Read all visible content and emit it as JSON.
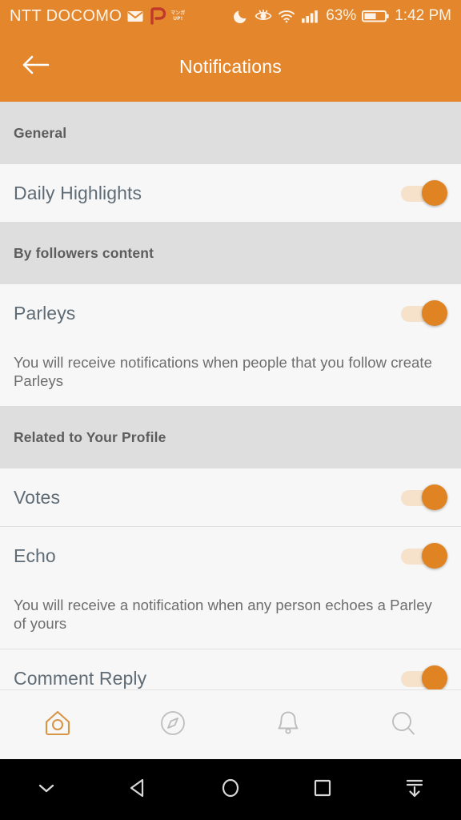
{
  "status_bar": {
    "carrier": "NTT DOCOMO",
    "battery_percent": "63%",
    "clock": "1:42 PM",
    "manga_badge_line1": "マンガ",
    "manga_badge_line2": "UP!",
    "icons": [
      "mail-icon",
      "parley-p-icon",
      "manga-up-badge-icon",
      "do-not-disturb-moon-icon",
      "eye-comfort-icon",
      "wifi-icon",
      "cellular-signal-icon",
      "battery-icon"
    ]
  },
  "app_bar": {
    "title": "Notifications",
    "back_label": "Back"
  },
  "colors": {
    "accent": "#e3862c",
    "toggle_on_thumb": "#e08323",
    "toggle_on_track": "#f6e2cb",
    "section_header_bg": "#dedede",
    "row_bg": "#f7f7f7",
    "row_title": "#5f6c76",
    "description_text": "#6d6d6d",
    "navbar_bg": "#000000"
  },
  "sections": [
    {
      "header": "General",
      "rows": [
        {
          "label": "Daily Highlights",
          "toggle": "on",
          "description": null
        }
      ]
    },
    {
      "header": "By followers content",
      "rows": [
        {
          "label": "Parleys",
          "toggle": "on",
          "description": "You will receive notifications when people that you follow create Parleys"
        }
      ]
    },
    {
      "header": "Related to Your Profile",
      "rows": [
        {
          "label": "Votes",
          "toggle": "on",
          "description": null
        },
        {
          "label": "Echo",
          "toggle": "on",
          "description": "You will receive a notification when any person echoes a Parley of yours"
        },
        {
          "label": "Comment Reply",
          "toggle": "on",
          "description": null
        }
      ]
    }
  ],
  "tab_bar": {
    "tabs": [
      {
        "name": "home",
        "icon": "home-icon",
        "active": true
      },
      {
        "name": "explore",
        "icon": "compass-icon",
        "active": false
      },
      {
        "name": "notifications",
        "icon": "bell-icon",
        "active": false
      },
      {
        "name": "search",
        "icon": "search-icon",
        "active": false
      }
    ]
  },
  "android_nav": {
    "buttons": [
      {
        "name": "hide-navbar",
        "icon": "chevron-down-icon"
      },
      {
        "name": "back",
        "icon": "back-triangle-icon"
      },
      {
        "name": "home",
        "icon": "home-circle-icon"
      },
      {
        "name": "recents",
        "icon": "recents-square-icon"
      },
      {
        "name": "pin-navbar",
        "icon": "pull-down-icon"
      }
    ]
  }
}
